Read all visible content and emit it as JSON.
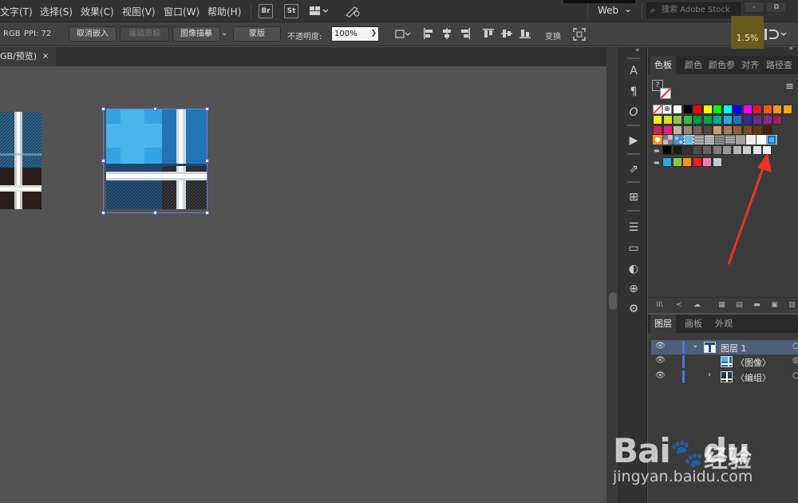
{
  "menubar": {
    "items": [
      "文字(T)",
      "选择(S)",
      "效果(C)",
      "视图(V)",
      "窗口(W)",
      "帮助(H)"
    ],
    "app_icons": [
      "Br",
      "St"
    ],
    "workspace": "Web",
    "workspace_arrow": "⌄",
    "search_placeholder": "搜索 Adobe Stock",
    "search_icon": "search-icon",
    "window_controls": [
      "–",
      "⧉"
    ]
  },
  "controlbar": {
    "color_mode": "RGB",
    "ppi": "PPI: 72",
    "unembed_label": "取消嵌入",
    "edit_original_label": "编辑原稿",
    "image_trace_label": "图像描摹",
    "mask_label": "蒙版",
    "opacity_label": "不透明度:",
    "opacity_value": "100%",
    "transform_label": "变换",
    "zoom_badge": "1.5%"
  },
  "document": {
    "tab_label": "GB/预览)",
    "tab_close": "×"
  },
  "swatches_panel": {
    "tabs": [
      "色板",
      "颜色",
      "颜色参",
      "对齐",
      "路径查"
    ],
    "active_tab": "色板",
    "help_glyph": "?",
    "menu_glyph": "≡",
    "row1": [
      "#ffffff",
      "#000000",
      "#ff0000",
      "#ffff00",
      "#00ff00",
      "#00ffff",
      "#0000ff",
      "#ff00ff",
      "#dc1e26",
      "#f05a22",
      "#f7941d",
      "#faa61a"
    ],
    "row2": [
      "#fff200",
      "#d7df23",
      "#8dc63f",
      "#39b54a",
      "#009444",
      "#00a651",
      "#00a99d",
      "#27aae1",
      "#1c75bc",
      "#2e3192",
      "#662d91",
      "#92278f",
      "#9e1f63"
    ],
    "row3": [
      "#da1c5c",
      "#ed1e79",
      "#c2b59b",
      "#998675",
      "#736357",
      "#534741",
      "#c69c6d",
      "#a67c52",
      "#8c6239",
      "#754c24",
      "#603913",
      "#42210b"
    ],
    "gray_row": [
      "#000000",
      "#1a1a1a",
      "#333333",
      "#4d4d4d",
      "#666666",
      "#808080",
      "#999999",
      "#b3b3b3",
      "#cccccc",
      "#e6e6e6",
      "#f2f2f2"
    ],
    "last_row": [
      "#29abe2",
      "#8cc63f",
      "#f7931e",
      "#ff1d25",
      "#ff7bac",
      "#bdccd4"
    ]
  },
  "layers_panel": {
    "tabs": [
      "图层",
      "画板",
      "外观"
    ],
    "active_tab": "图层",
    "rows": [
      {
        "name": "图层 1",
        "expanded": true
      },
      {
        "name": "〈图像〉",
        "expanded": false
      },
      {
        "name": "〈编组〉",
        "expanded": false
      }
    ]
  },
  "tools": [
    "A",
    "¶",
    "O",
    "▶",
    "⇗",
    "⊞",
    "☰",
    "▭",
    "◐",
    "⊕",
    "⚙"
  ],
  "watermark": {
    "logo": "Bai🐾du",
    "cn": "经验",
    "url": "jingyan.baidu.com"
  }
}
